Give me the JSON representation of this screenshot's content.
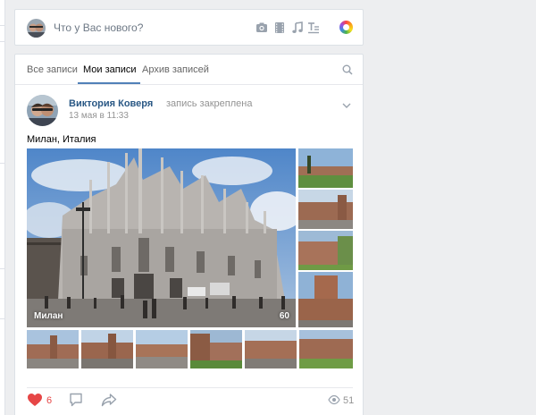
{
  "composer": {
    "placeholder": "Что у Вас нового?",
    "tools": [
      "camera-icon",
      "video-icon",
      "music-icon",
      "text-format-icon",
      "color-picker-icon"
    ]
  },
  "tabs": [
    {
      "label": "Все записи",
      "active": false
    },
    {
      "label": "Мои записи",
      "active": true
    },
    {
      "label": "Архив записей",
      "active": false
    }
  ],
  "post": {
    "author": "Виктория Коверя",
    "status": "запись закреплена",
    "date": "13 мая в 11:33",
    "text": "Милан, Италия",
    "main_photo": {
      "label": "Милан",
      "count": "60"
    },
    "thumbnails": 10,
    "likes": "6",
    "views": "51"
  },
  "colors": {
    "link": "#2a5885",
    "accent": "#5181b8",
    "like": "#e64646",
    "muted": "#939393"
  }
}
